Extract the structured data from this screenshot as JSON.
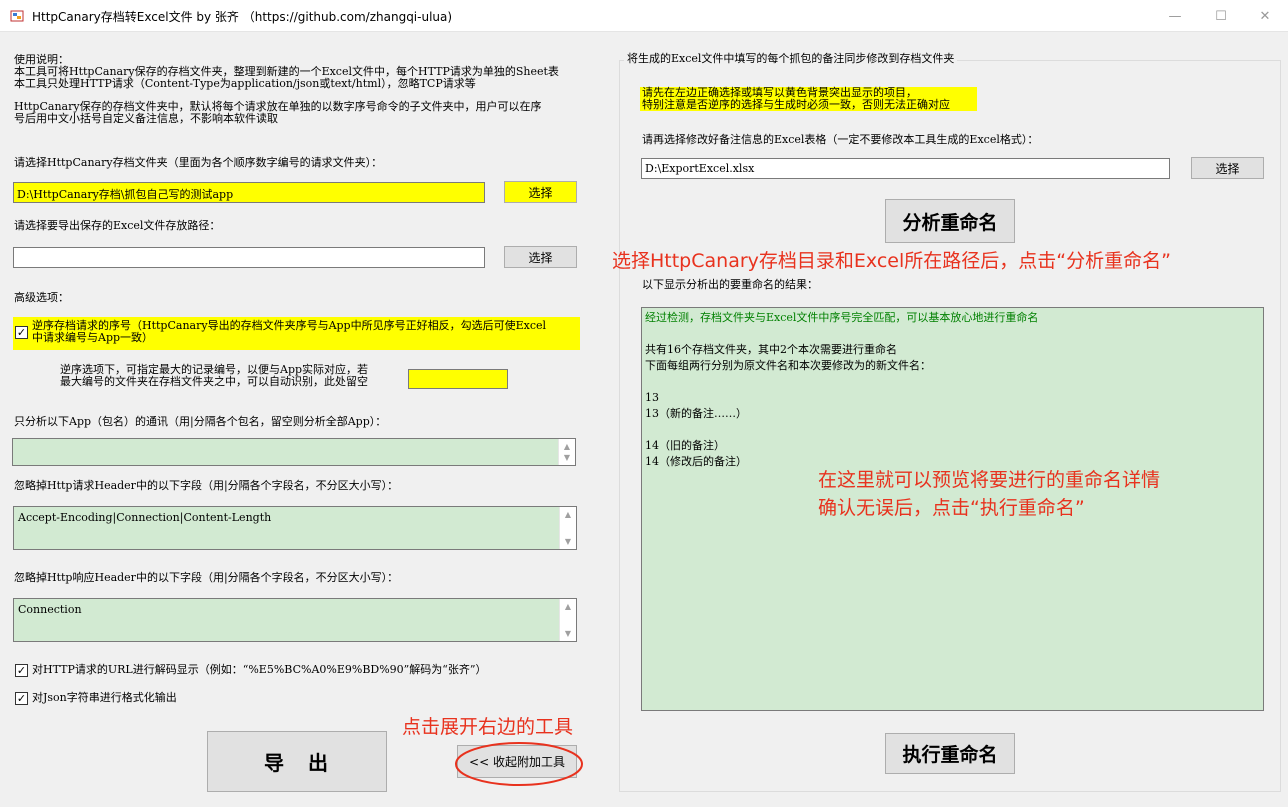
{
  "window": {
    "title": "HttpCanary存档转Excel文件 by 张齐 （https://github.com/zhangqi-ulua)",
    "icon": "app-icon",
    "minimize_glyph": "—",
    "maximize_glyph": "☐",
    "close_glyph": "✕"
  },
  "left": {
    "instructions": [
      "使用说明：",
      "本工具可将HttpCanary保存的存档文件夹，整理到新建的一个Excel文件中，每个HTTP请求为单独的Sheet表",
      "本工具只处理HTTP请求（Content-Type为application/json或text/html），忽略TCP请求等"
    ],
    "instructions2": [
      "HttpCanary保存的存档文件夹中，默认将每个请求放在单独的以数字序号命令的子文件夹中，用户可以在序",
      "号后用中文小括号自定义备注信息，不影响本软件读取"
    ],
    "folder_label": "请选择HttpCanary存档文件夹（里面为各个顺序数字编号的请求文件夹）：",
    "folder_value": "D:\\HttpCanary存档\\抓包自己写的测试app",
    "select_label": "选择",
    "export_label": "请选择要导出保存的Excel文件存放路径：",
    "export_value": "",
    "advanced_label": "高级选项：",
    "reverse_text": [
      "逆序存档请求的序号（HttpCanary导出的存档文件夹序号与App中所见序号正好相反，勾选后可使Excel",
      "中请求编号与App一致）"
    ],
    "reverse_checked": "✓",
    "reverse_hint": [
      "逆序选项下，可指定最大的记录编号，以便与App实际对应，若",
      "最大编号的文件夹在存档文件夹之中，可以自动识别，此处留空"
    ],
    "max_number_value": "",
    "app_filter_label": "只分析以下App（包名）的通讯（用|分隔各个包名，留空则分析全部App）：",
    "app_filter_value": "",
    "req_header_label": "忽略掉Http请求Header中的以下字段（用|分隔各个字段名，不分区大小写）：",
    "req_header_value": "Accept-Encoding|Connection|Content-Length",
    "resp_header_label": "忽略掉Http响应Header中的以下字段（用|分隔各个字段名，不分区大小写）：",
    "resp_header_value": "Connection",
    "url_decode_label": "对HTTP请求的URL进行解码显示（例如：“%E5%BC%A0%E9%BD%90”解码为“张齐”）",
    "json_format_label": "对Json字符串进行格式化输出",
    "url_decode_checked": "✓",
    "json_format_checked": "✓",
    "export_button": "导　出",
    "collapse_button": "<< 收起附加工具"
  },
  "right": {
    "group_title": "将生成的Excel文件中填写的每个抓包的备注同步修改到存档文件夹",
    "notice": [
      "请先在左边正确选择或填写以黄色背景突出显示的项目，",
      "特别注意是否逆序的选择与生成时必须一致，否则无法正确对应"
    ],
    "excel_label": "请再选择修改好备注信息的Excel表格（一定不要修改本工具生成的Excel格式）：",
    "excel_value": "D:\\ExportExcel.xlsx",
    "select_label": "选择",
    "analyze_button": "分析重命名",
    "result_label": "以下显示分析出的要重命名的结果：",
    "result_status": "经过检测，存档文件夹与Excel文件中序号完全匹配，可以基本放心地进行重命名",
    "result_lines": [
      "",
      "共有16个存档文件夹，其中2个本次需要进行重命名",
      "下面每组两行分别为原文件名和本次要修改为的新文件名：",
      "",
      "13",
      "13（新的备注……）",
      "",
      "14（旧的备注）",
      "14（修改后的备注）"
    ],
    "execute_button": "执行重命名"
  },
  "annotations": {
    "analyze_hint": "选择HttpCanary存档目录和Excel所在路径后，点击“分析重命名”",
    "preview_hint": [
      "在这里就可以预览将要进行的重命名详情",
      "确认无误后，点击“执行重命名”"
    ],
    "expand_hint": "点击展开右边的工具"
  },
  "colors": {
    "highlight": "#ffff00",
    "textarea_bg": "#d2ead2",
    "status_green": "#008000",
    "annotation_red": "#e8321e"
  }
}
